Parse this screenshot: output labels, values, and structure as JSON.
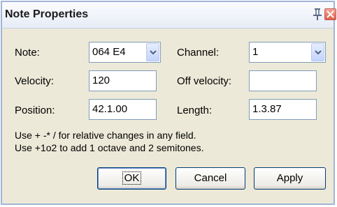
{
  "window": {
    "title": "Note Properties"
  },
  "fields": {
    "note": {
      "label": "Note:",
      "value": "064 E4"
    },
    "channel": {
      "label": "Channel:",
      "value": "1"
    },
    "velocity": {
      "label": "Velocity:",
      "value": "120"
    },
    "off_velocity": {
      "label": "Off velocity:",
      "value": ""
    },
    "position": {
      "label": "Position:",
      "value": "42.1.00"
    },
    "length": {
      "label": "Length:",
      "value": "1.3.87"
    }
  },
  "help": {
    "line1": "Use + -* / for relative changes in any field.",
    "line2": "Use +1o2  to add 1 octave and 2 semitones."
  },
  "buttons": {
    "ok": "OK",
    "cancel": "Cancel",
    "apply": "Apply"
  },
  "icons": {
    "pin": "pin-icon",
    "close": "close-icon",
    "dropdown": "chevron-down-icon"
  }
}
